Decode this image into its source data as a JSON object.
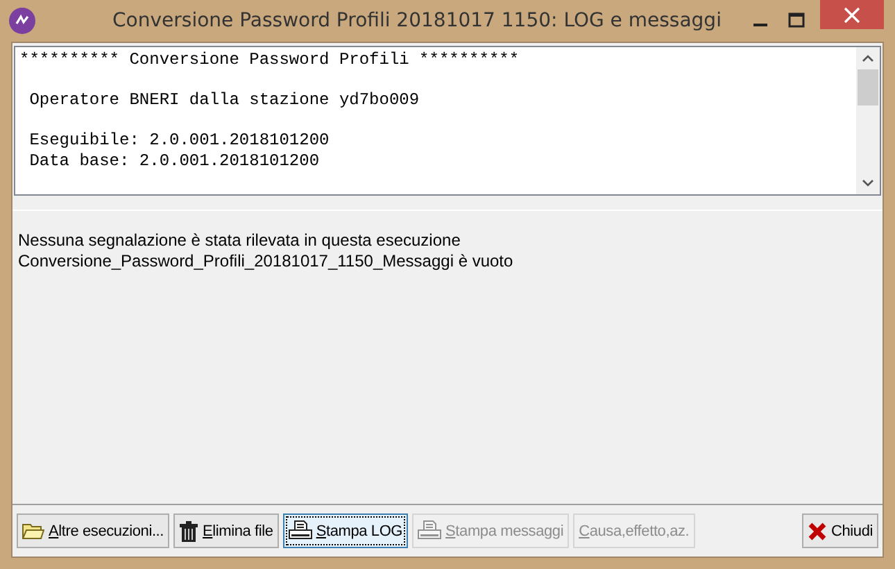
{
  "window": {
    "title": "Conversione Password Profili 20181017 1150: LOG e messaggi"
  },
  "log_blocks": [
    [
      "********** Conversione Password Profili **********"
    ],
    [
      " Operatore BNERI dalla stazione yd7bo009"
    ],
    [
      " Eseguibile: 2.0.001.2018101200",
      " Data base: 2.0.001.2018101200"
    ]
  ],
  "messages": [
    "Nessuna segnalazione è stata rilevata in questa esecuzione",
    "Conversione_Password_Profili_20181017_1150_Messaggi è vuoto"
  ],
  "buttons": [
    {
      "kind": "folder",
      "mnemonic": "A",
      "rest": "ltre esecuzioni...",
      "disabled": false,
      "focused": false
    },
    {
      "kind": "trash",
      "mnemonic": "E",
      "rest": "limina file",
      "disabled": false,
      "focused": false
    },
    {
      "kind": "printer",
      "mnemonic": "S",
      "rest": "tampa LOG",
      "disabled": false,
      "focused": true
    },
    {
      "kind": "printer",
      "mnemonic": "S",
      "rest": "tampa messaggi",
      "disabled": true,
      "focused": false
    },
    {
      "kind": "text",
      "mnemonic": "C",
      "rest": "ausa,effetto,az.",
      "disabled": true,
      "focused": false
    },
    {
      "kind": "close",
      "rest": "Chiudi",
      "disabled": false,
      "focused": false
    }
  ]
}
